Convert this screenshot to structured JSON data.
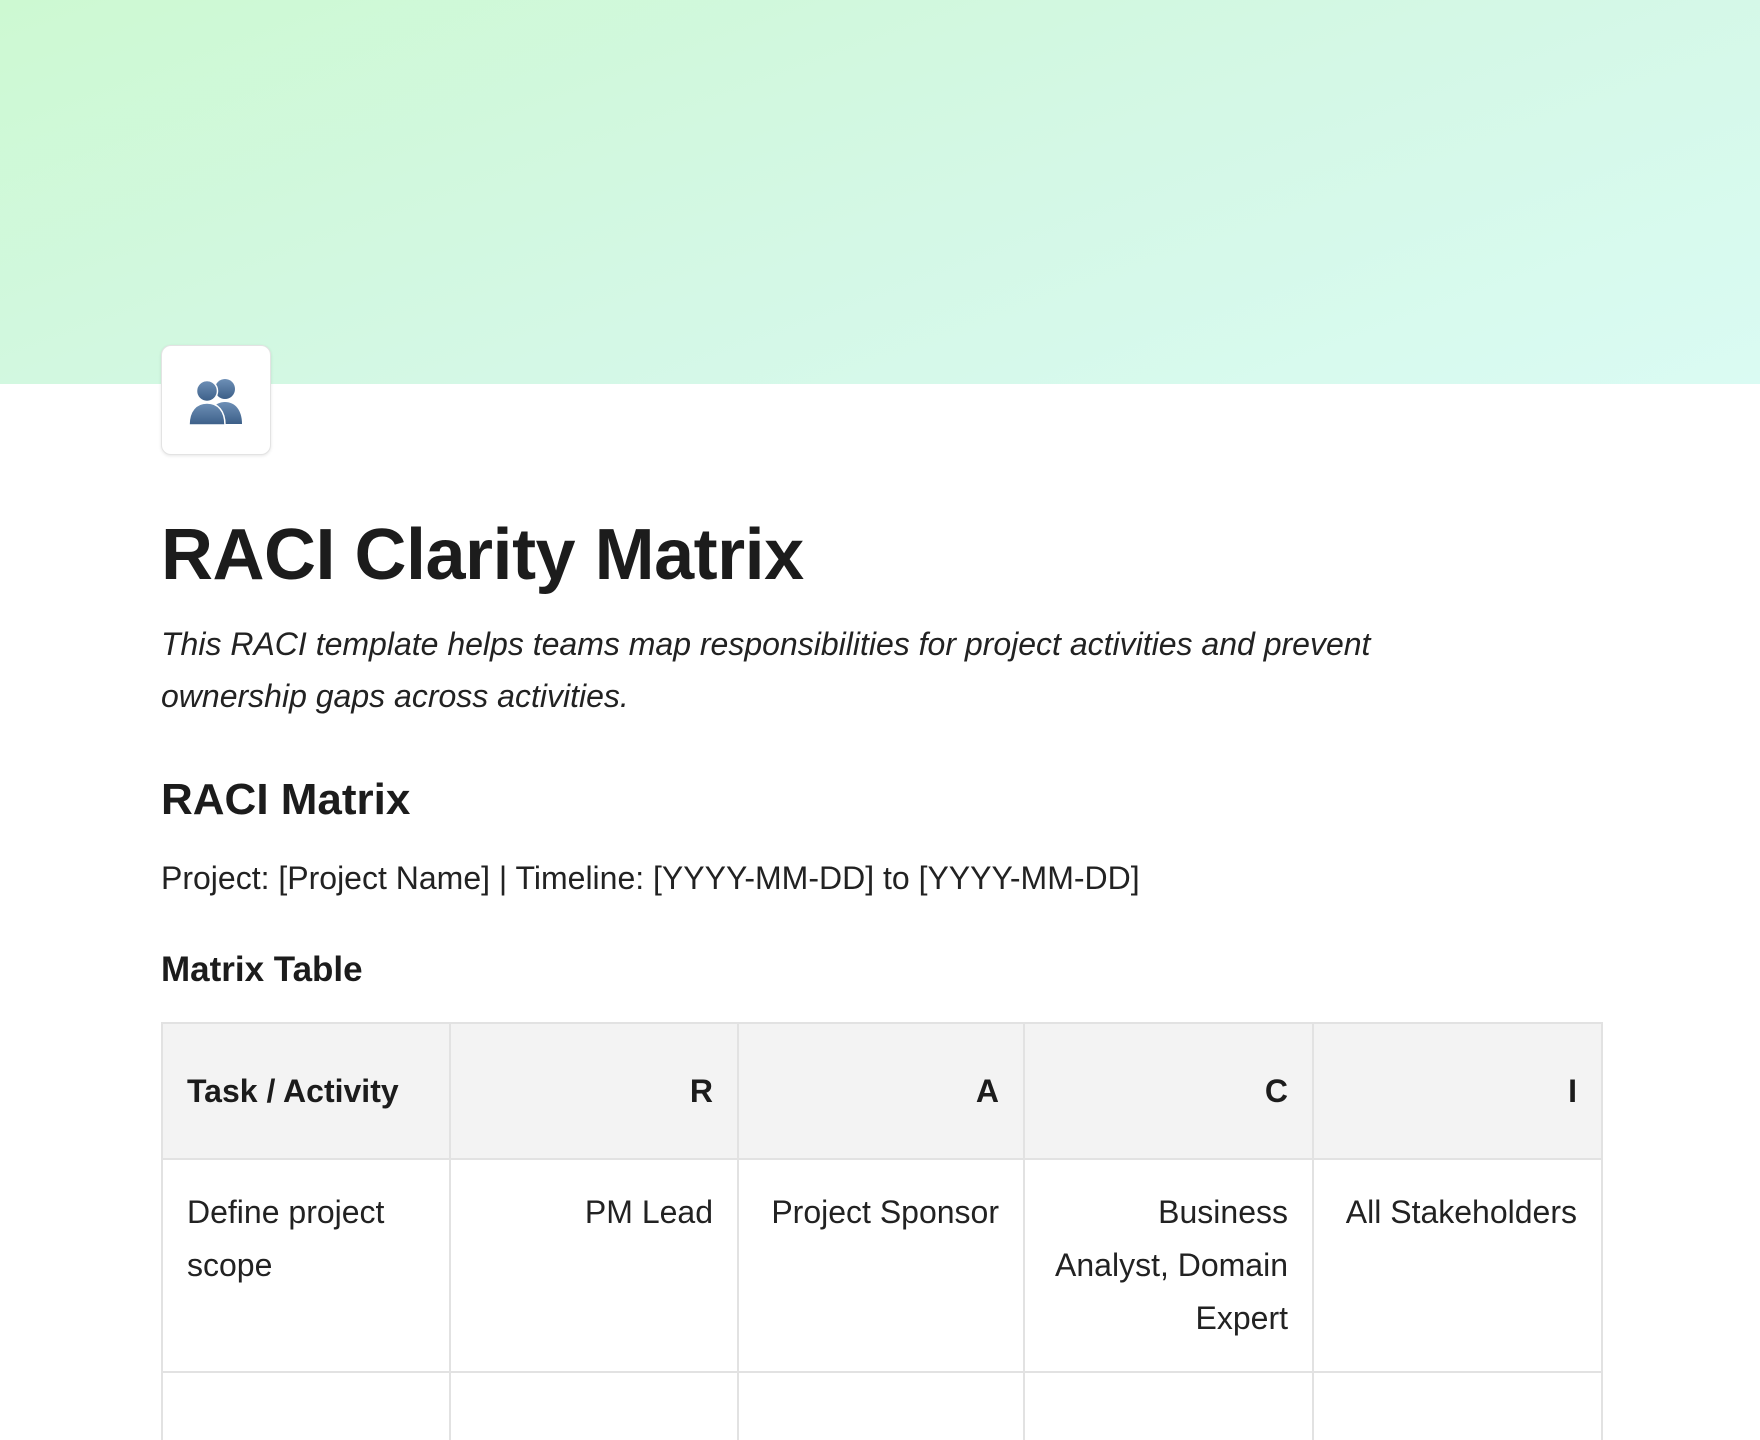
{
  "page": {
    "icon": "busts-in-silhouette-icon",
    "title": "RACI Clarity Matrix",
    "description": "This RACI template helps teams map responsibilities for project activities and prevent ownership gaps across activities."
  },
  "section": {
    "heading": "RACI Matrix",
    "project_line": "Project: [Project Name] | Timeline: [YYYY-MM-DD] to [YYYY-MM-DD]",
    "subheading": "Matrix Table"
  },
  "table": {
    "headers": [
      "Task / Activity",
      "R",
      "A",
      "C",
      "I"
    ],
    "rows": [
      {
        "cells": [
          "Define project scope",
          "PM Lead",
          "Project Sponsor",
          "Business Analyst, Domain Expert",
          "All Stakeholders"
        ]
      },
      {
        "cells": [
          "",
          "",
          "",
          "",
          ""
        ]
      }
    ]
  },
  "colors": {
    "cover_gradient_start": "#cdf9d2",
    "cover_gradient_end": "#dafbf3",
    "header_background": "#f3f3f3",
    "border": "#e2e2e2"
  }
}
